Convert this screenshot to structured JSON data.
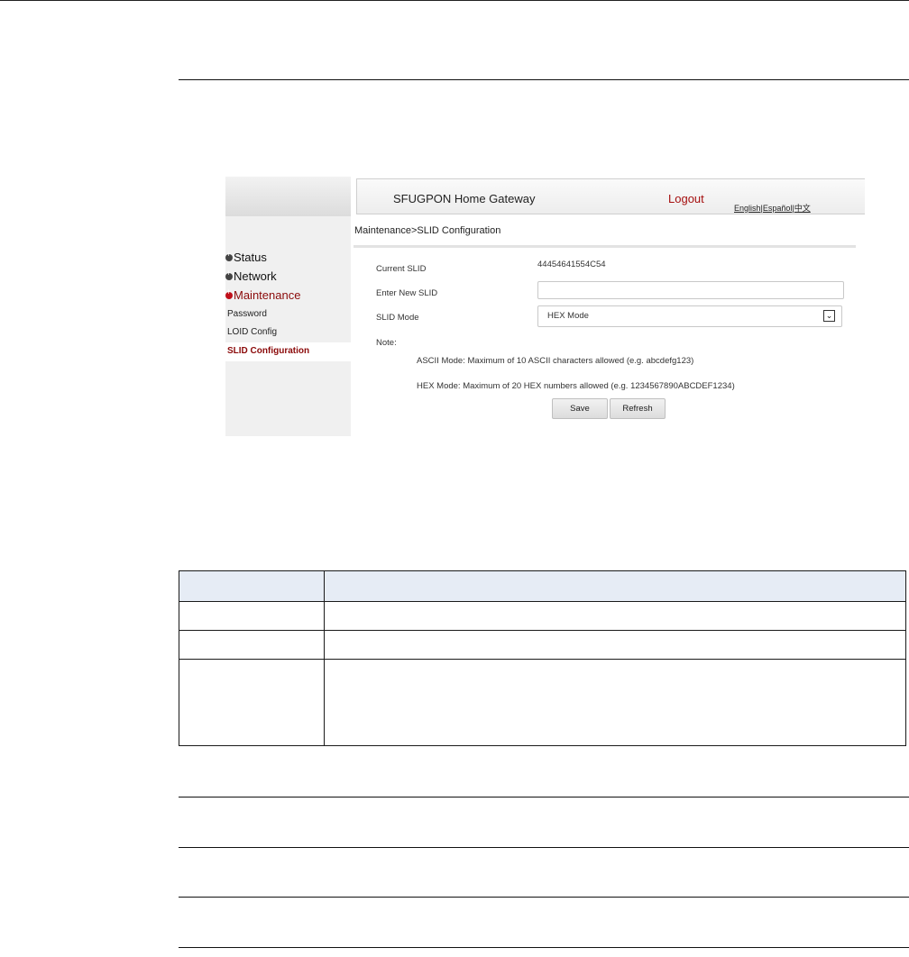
{
  "gateway": {
    "title": "SFUGPON Home Gateway",
    "logout": "Logout",
    "languages": [
      "English",
      "Español",
      "中文"
    ],
    "breadcrumb": "Maintenance>SLID Configuration",
    "nav": {
      "status": "Status",
      "network": "Network",
      "maintenance": "Maintenance",
      "password": "Password",
      "loid_config": "LOID Config",
      "slid_configuration": "SLID Configuration"
    },
    "form": {
      "current_slid_label": "Current SLID",
      "current_slid_value": "44454641554C54",
      "new_slid_label": "Enter New SLID",
      "new_slid_value": "",
      "slid_mode_label": "SLID Mode",
      "slid_mode_value": "HEX Mode",
      "note_label": "Note:",
      "note_ascii": "ASCII Mode: Maximum of 10 ASCII characters allowed (e.g. abcdefg123)",
      "note_hex": "HEX Mode: Maximum of 20 HEX numbers allowed (e.g. 1234567890ABCDEF1234)"
    },
    "buttons": {
      "save": "Save",
      "refresh": "Refresh"
    }
  },
  "colors": {
    "accent": "#a50f0f",
    "table_header": "#e6ecf5"
  }
}
